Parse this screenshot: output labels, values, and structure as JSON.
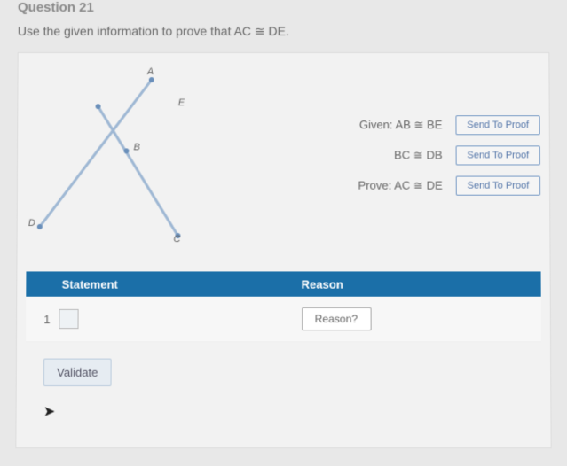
{
  "header": {
    "question_label": "Question 21",
    "instruction": "Use the given information to prove that AC ≅ DE."
  },
  "figure": {
    "points": {
      "A": "A",
      "B": "B",
      "C": "C",
      "D": "D",
      "E": "E"
    }
  },
  "givens": {
    "rows": [
      {
        "label": "Given:",
        "expr": "AB ≅ BE",
        "btn": "Send To Proof"
      },
      {
        "label": "",
        "expr": "BC ≅ DB",
        "btn": "Send To Proof"
      },
      {
        "label": "Prove:",
        "expr": "AC ≅ DE",
        "btn": "Send To Proof"
      }
    ]
  },
  "table": {
    "headers": {
      "statement": "Statement",
      "reason": "Reason"
    },
    "rows": [
      {
        "num": "1",
        "statement": "",
        "reason_btn": "Reason?"
      }
    ]
  },
  "actions": {
    "validate": "Validate"
  }
}
